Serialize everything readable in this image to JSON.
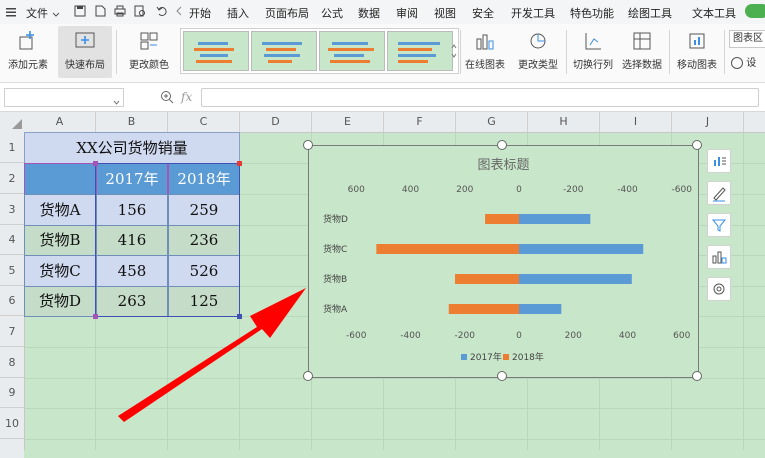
{
  "menubar": {
    "file_label": "文件",
    "tabs": [
      "开始",
      "插入",
      "页面布局",
      "公式",
      "数据",
      "审阅",
      "视图",
      "安全",
      "开发工具",
      "特色功能",
      "绘图工具",
      "文本工具"
    ]
  },
  "ribbon": {
    "add_element": "添加元素",
    "quick_layout": "快速布局",
    "change_color": "更改颜色",
    "online_chart": "在线图表",
    "change_type": "更改类型",
    "switch_row_col": "切换行列",
    "select_data": "选择数据",
    "move_chart": "移动图表",
    "chart_area_partial": "图表区",
    "settings_partial": "设"
  },
  "formula_bar": {
    "name_value": "",
    "fx_label": "fx",
    "formula_value": ""
  },
  "sheet": {
    "columns": [
      "A",
      "B",
      "C",
      "D",
      "E",
      "F",
      "G",
      "H",
      "I",
      "J"
    ],
    "rows": [
      "1",
      "2",
      "3",
      "4",
      "5",
      "6",
      "7",
      "8",
      "9",
      "10"
    ],
    "table": {
      "title": "XX公司货物销量",
      "headers": [
        "",
        "2017年",
        "2018年"
      ],
      "rows": [
        {
          "name": "货物A",
          "y2017": "156",
          "y2018": "259"
        },
        {
          "name": "货物B",
          "y2017": "416",
          "y2018": "236"
        },
        {
          "name": "货物C",
          "y2017": "458",
          "y2018": "526"
        },
        {
          "name": "货物D",
          "y2017": "263",
          "y2018": "125"
        }
      ]
    }
  },
  "chart_data": {
    "type": "bar",
    "orientation": "horizontal",
    "title": "图表标题",
    "categories": [
      "货物A",
      "货物B",
      "货物C",
      "货物D"
    ],
    "series": [
      {
        "name": "2017年",
        "values": [
          156,
          416,
          458,
          263
        ],
        "color": "#5b9bd5"
      },
      {
        "name": "2018年",
        "values": [
          -259,
          -236,
          -526,
          -125
        ],
        "color": "#ed7d31"
      }
    ],
    "x_top_ticks": [
      "600",
      "400",
      "200",
      "0",
      "-200",
      "-400",
      "-600"
    ],
    "x_bottom_ticks": [
      "-600",
      "-400",
      "-200",
      "0",
      "200",
      "400",
      "600"
    ],
    "xlim": [
      -600,
      600
    ],
    "legend": "bottom",
    "grid": false
  },
  "colors": {
    "header_blue": "#5b9bd5",
    "cell_fill": "#cfd9ef",
    "sheet_bg": "#c8e6c9",
    "arrow": "#ff0000"
  },
  "side_tools": [
    "chart-elements-icon",
    "chart-style-icon",
    "chart-filter-icon",
    "online-chart-icon",
    "chart-settings-icon"
  ]
}
